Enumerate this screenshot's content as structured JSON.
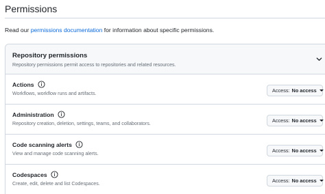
{
  "page": {
    "title": "Permissions",
    "intro_prefix": "Read our ",
    "intro_link": "permissions documentation",
    "intro_suffix": " for information about specific permissions."
  },
  "section": {
    "title": "Repository permissions",
    "subtitle": "Repository permissions permit access to repositories and related resources.",
    "toggle_icon": "chevron-down-icon"
  },
  "access_label": "Access:",
  "permissions": [
    {
      "name": "Actions",
      "description": "Workflows, workflow runs and artifacts.",
      "access": "No access"
    },
    {
      "name": "Administration",
      "description": "Repository creation, deletion, settings, teams, and collaborators.",
      "access": "No access"
    },
    {
      "name": "Code scanning alerts",
      "description": "View and manage code scanning alerts.",
      "access": "No access"
    },
    {
      "name": "Codespaces",
      "description": "Create, edit, delete and list Codespaces.",
      "access": "No access"
    }
  ],
  "colors": {
    "link": "#0969da",
    "border": "#d0d7de",
    "muted_text": "#656d76",
    "header_bg": "#f6f8fa"
  }
}
